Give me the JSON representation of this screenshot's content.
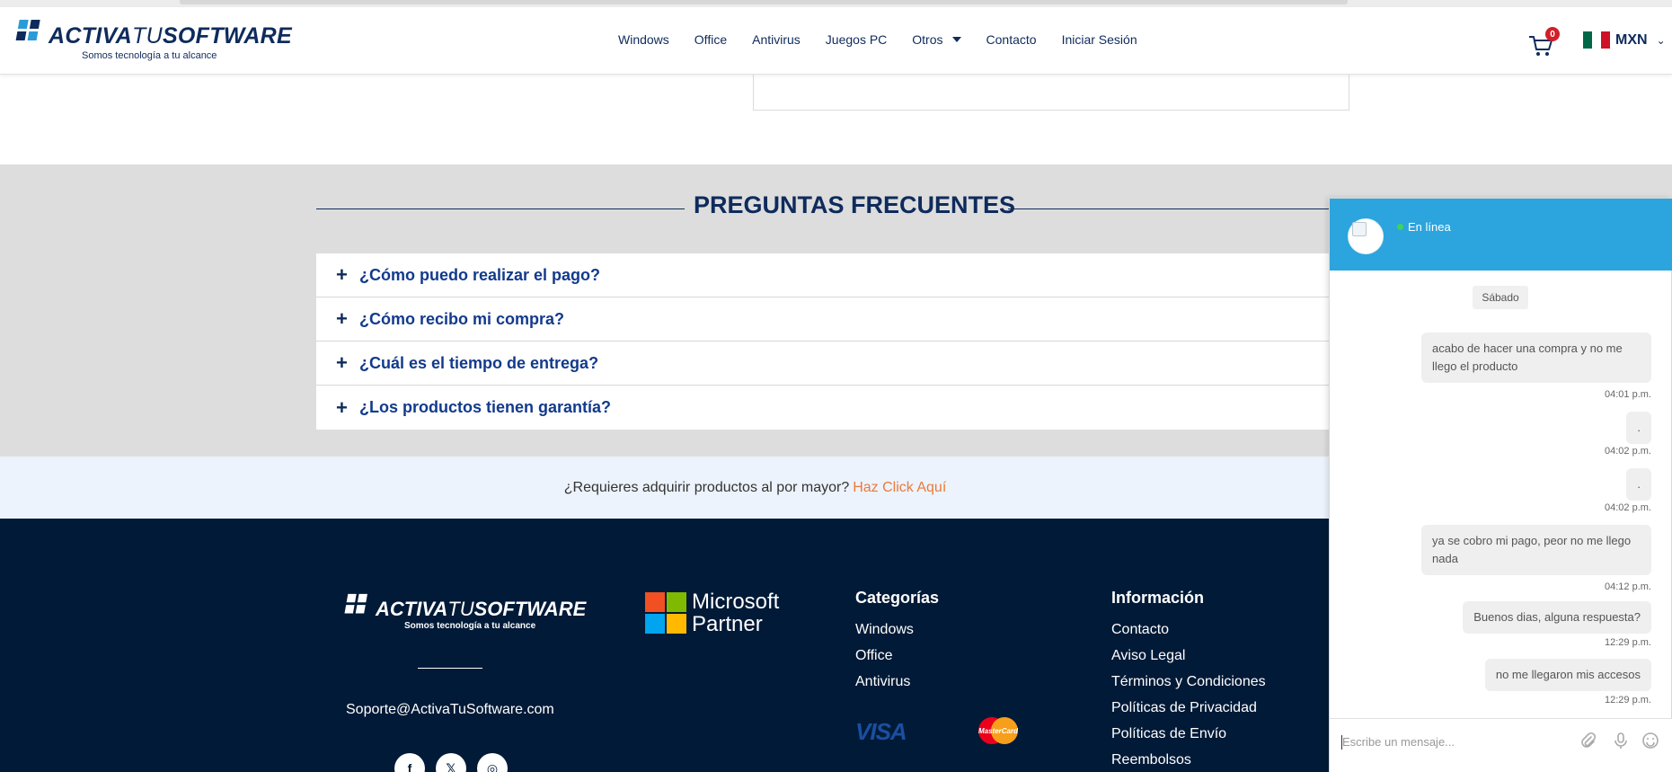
{
  "header": {
    "logo": {
      "brand_a": "ACTIVA",
      "brand_b": "TU",
      "brand_c": "SOFTWARE",
      "tagline": "Somos tecnología a tu alcance"
    },
    "nav": [
      {
        "label": "Windows"
      },
      {
        "label": "Office"
      },
      {
        "label": "Antivirus"
      },
      {
        "label": "Juegos PC"
      },
      {
        "label": "Otros"
      },
      {
        "label": "Contacto"
      },
      {
        "label": "Iniciar Sesión"
      }
    ],
    "cart_count": "0",
    "currency": "MXN",
    "colors": {
      "brand": "#0e2b5c",
      "badge": "#d0202a"
    }
  },
  "faq": {
    "title": "PREGUNTAS FRECUENTES",
    "items": [
      {
        "question": "¿Cómo puedo realizar el pago?"
      },
      {
        "question": "¿Cómo recibo mi compra?"
      },
      {
        "question": "¿Cuál es el tiempo de entrega?"
      },
      {
        "question": "¿Los productos tienen garantía?"
      }
    ]
  },
  "wholesale": {
    "text": "¿Requieres adquirir productos al por mayor?",
    "link": "Haz Click Aquí"
  },
  "footer": {
    "logo": {
      "brand_a": "ACTIVA",
      "brand_b": "TU",
      "brand_c": "SOFTWARE",
      "tagline": "Somos tecnología a tu alcance"
    },
    "email": "Soporte@ActivaTuSoftware.com",
    "partner": {
      "line1": "Microsoft",
      "line2": "Partner"
    },
    "categories": {
      "title": "Categorías",
      "links": [
        "Windows",
        "Office",
        "Antivirus"
      ]
    },
    "info": {
      "title": "Información",
      "links": [
        "Contacto",
        "Aviso Legal",
        "Términos y Condiciones",
        "Políticas de Privacidad",
        "Políticas de Envío",
        "Reembolsos"
      ]
    },
    "payments": {
      "visa": "VISA",
      "mastercard": "MasterCard"
    },
    "socials": [
      "facebook-icon",
      "x-icon",
      "instagram-icon"
    ]
  },
  "chat": {
    "status": "En línea",
    "day": "Sábado",
    "messages": [
      {
        "text": "acabo de hacer una compra y no me llego el producto",
        "time": "04:01 p.m."
      },
      {
        "text": ".",
        "time": "04:02 p.m."
      },
      {
        "text": ".",
        "time": "04:02 p.m."
      },
      {
        "text": "ya se cobro mi pago, peor no me llego nada",
        "time": "04:12 p.m."
      },
      {
        "text": "Buenos dias, alguna respuesta?",
        "time": "12:29 p.m."
      },
      {
        "text": "no me llegaron mis accesos",
        "time": "12:29 p.m."
      }
    ],
    "input_placeholder": "Escribe un mensaje...",
    "colors": {
      "header": "#2ca4dd",
      "online": "#3cd45a"
    }
  }
}
